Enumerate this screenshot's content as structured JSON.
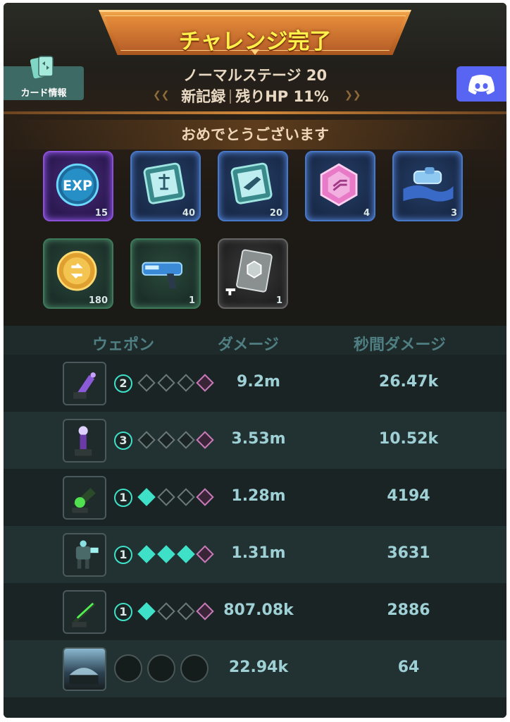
{
  "header": {
    "title": "チャレンジ完了",
    "card_info_label": "カード情報",
    "stage": "ノーマルステージ 20",
    "new_record": "新記録",
    "hp_remaining": "残りHP 11%"
  },
  "rewards": {
    "congrats": "おめでとうございます",
    "items": [
      {
        "icon": "exp-orb-icon",
        "label": "EXP",
        "count": "15",
        "rarity": "purple"
      },
      {
        "icon": "blueprint-crate-icon",
        "count": "40",
        "rarity": "blue"
      },
      {
        "icon": "weapon-crate-icon",
        "count": "20",
        "rarity": "blue"
      },
      {
        "icon": "pink-hex-chip-icon",
        "count": "4",
        "rarity": "blue"
      },
      {
        "icon": "blueprint-scroll-icon",
        "count": "3",
        "rarity": "blue"
      },
      {
        "icon": "gold-coin-icon",
        "count": "180",
        "rarity": "green"
      },
      {
        "icon": "blue-pistol-icon",
        "count": "1",
        "rarity": "green"
      },
      {
        "icon": "silver-chip-icon",
        "count": "1",
        "rarity": "gray"
      }
    ]
  },
  "table": {
    "headers": {
      "weapon": "ウェポン",
      "damage": "ダメージ",
      "dps": "秒間ダメージ"
    },
    "rows": [
      {
        "icon": "purple-drill-turret-icon",
        "level": "2",
        "stars": 0,
        "damage": "9.2m",
        "dps": "26.47k"
      },
      {
        "icon": "tesla-orb-turret-icon",
        "level": "3",
        "stars": 0,
        "damage": "3.53m",
        "dps": "10.52k"
      },
      {
        "icon": "green-cannon-turret-icon",
        "level": "1",
        "stars": 1,
        "damage": "1.28m",
        "dps": "4194"
      },
      {
        "icon": "mech-robot-icon",
        "level": "1",
        "stars": 3,
        "damage": "1.31m",
        "dps": "3631"
      },
      {
        "icon": "green-laser-turret-icon",
        "level": "1",
        "stars": 1,
        "damage": "807.08k",
        "dps": "2886"
      },
      {
        "icon": "dome-base-icon",
        "level": null,
        "stars": null,
        "damage": "22.94k",
        "dps": "64"
      }
    ]
  },
  "colors": {
    "title_text": "#fff14a",
    "banner": "#d07a30",
    "accent_teal": "#3fe0c8",
    "discord": "#5865f2"
  }
}
